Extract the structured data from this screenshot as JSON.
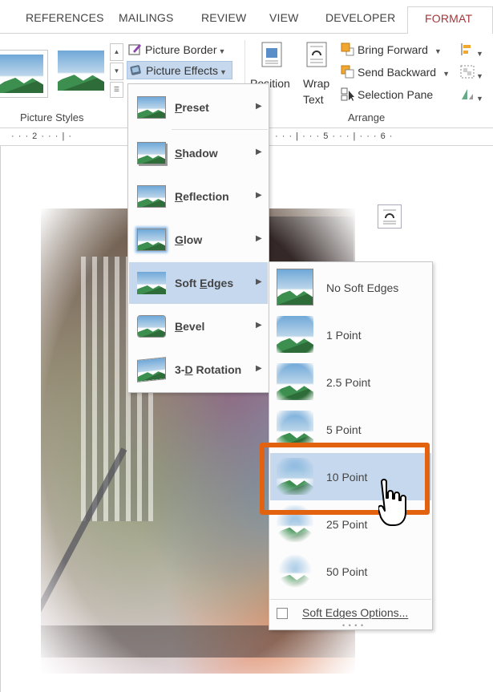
{
  "tabs": [
    "REFERENCES",
    "MAILINGS",
    "REVIEW",
    "VIEW",
    "DEVELOPER",
    "FORMAT"
  ],
  "active_tab": "FORMAT",
  "ribbon": {
    "picture_styles_label": "Picture Styles",
    "arrange_label": "Arrange",
    "picture_border": "Picture Border",
    "picture_effects": "Picture Effects",
    "position": "Position",
    "wrap_text_1": "Wrap",
    "wrap_text_2": "Text",
    "bring_forward": "Bring Forward",
    "send_backward": "Send Backward",
    "selection_pane": "Selection Pane"
  },
  "ruler": {
    "left": "· · · 2 · · · | ·",
    "right": "· · · | · · · 5 · · · | · · · 6 ·"
  },
  "picture_effects_menu": [
    {
      "label": "Preset",
      "key": "P"
    },
    {
      "label": "Shadow",
      "key": "S"
    },
    {
      "label": "Reflection",
      "key": "R"
    },
    {
      "label": "Glow",
      "key": "G"
    },
    {
      "label": "Soft Edges",
      "key": "E"
    },
    {
      "label": "Bevel",
      "key": "B"
    },
    {
      "label": "3-D Rotation",
      "key": "D"
    }
  ],
  "soft_edges_menu": [
    "No Soft Edges",
    "1 Point",
    "2.5 Point",
    "5 Point",
    "10 Point",
    "25 Point",
    "50 Point"
  ],
  "soft_edges_options": "Soft Edges Options...",
  "colors": {
    "active_tab": "#a4373a",
    "menu_hover": "#c5d8ee",
    "highlight_box": "#e2620f"
  }
}
